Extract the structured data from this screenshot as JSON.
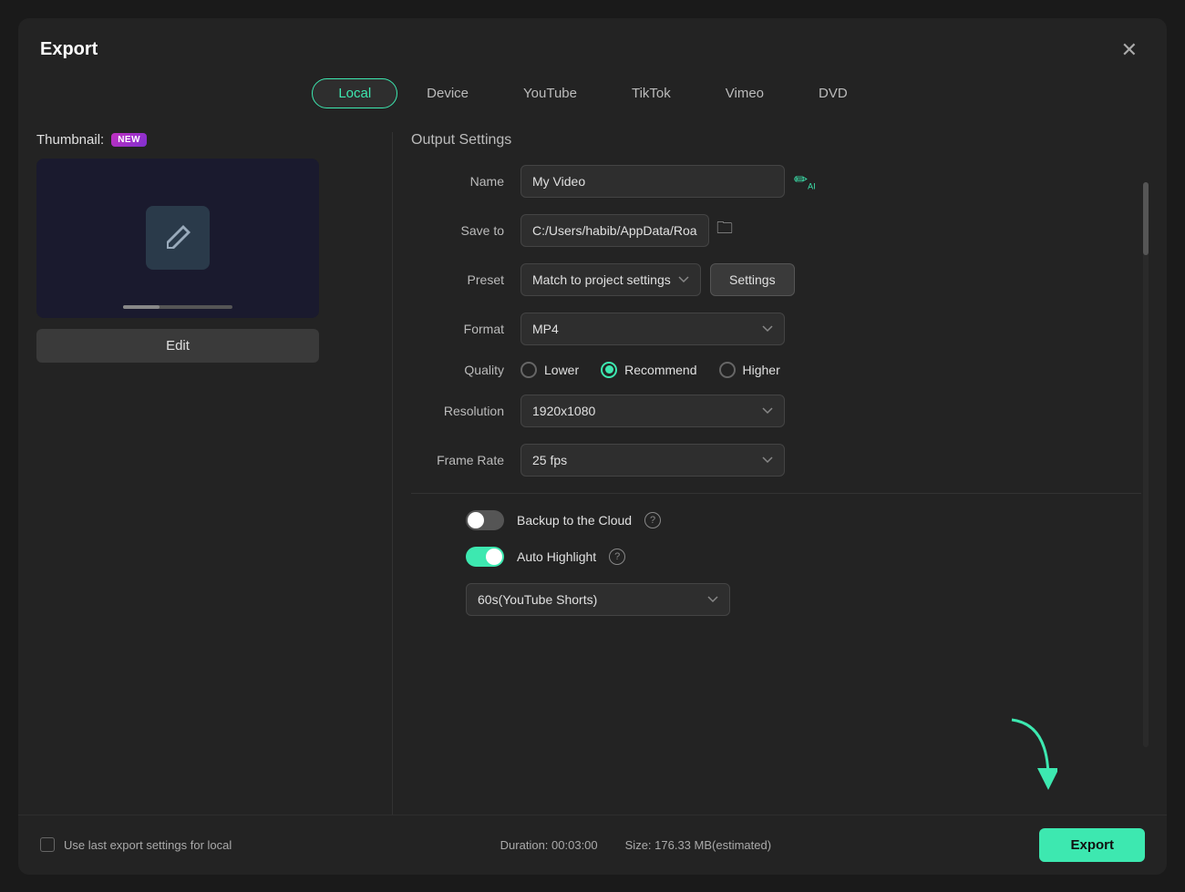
{
  "dialog": {
    "title": "Export",
    "close_label": "✕"
  },
  "tabs": [
    {
      "id": "local",
      "label": "Local",
      "active": true
    },
    {
      "id": "device",
      "label": "Device",
      "active": false
    },
    {
      "id": "youtube",
      "label": "YouTube",
      "active": false
    },
    {
      "id": "tiktok",
      "label": "TikTok",
      "active": false
    },
    {
      "id": "vimeo",
      "label": "Vimeo",
      "active": false
    },
    {
      "id": "dvd",
      "label": "DVD",
      "active": false
    }
  ],
  "thumbnail": {
    "label": "Thumbnail:",
    "new_badge": "NEW",
    "edit_button": "Edit"
  },
  "output": {
    "section_title": "Output Settings",
    "name_label": "Name",
    "name_value": "My Video",
    "save_to_label": "Save to",
    "save_to_value": "C:/Users/habib/AppData/Roar",
    "preset_label": "Preset",
    "preset_value": "Match to project settings",
    "settings_btn": "Settings",
    "format_label": "Format",
    "format_value": "MP4",
    "quality_label": "Quality",
    "quality_options": [
      {
        "id": "lower",
        "label": "Lower",
        "checked": false
      },
      {
        "id": "recommend",
        "label": "Recommend",
        "checked": true
      },
      {
        "id": "higher",
        "label": "Higher",
        "checked": false
      }
    ],
    "resolution_label": "Resolution",
    "resolution_value": "1920x1080",
    "frame_rate_label": "Frame Rate",
    "frame_rate_value": "25 fps",
    "backup_label": "Backup to the Cloud",
    "backup_on": false,
    "auto_highlight_label": "Auto Highlight",
    "auto_highlight_on": true,
    "shorts_value": "60s(YouTube Shorts)"
  },
  "footer": {
    "checkbox_label": "Use last export settings for local",
    "duration_label": "Duration: 00:03:00",
    "size_label": "Size: 176.33 MB(estimated)",
    "export_button": "Export"
  },
  "icons": {
    "close": "✕",
    "folder": "🗀",
    "pencil_ai": "✏",
    "chevron": "▾",
    "help": "?"
  }
}
